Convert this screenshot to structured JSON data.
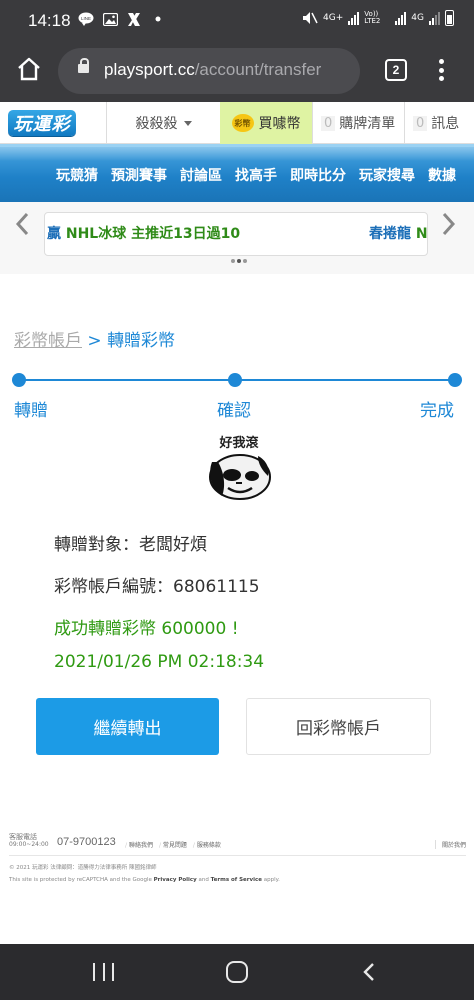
{
  "status_bar": {
    "time": "14:18",
    "network_label_1": "4G+",
    "network_label_2": "Vo)) LTE2",
    "network_label_3": "4G"
  },
  "browser": {
    "url_host": "playsport.cc",
    "url_path": "/account/transfer",
    "tab_count": "2"
  },
  "site_header": {
    "logo_text": "玩運彩",
    "user_name": "殺殺殺",
    "buy_coin_label": "買噱幣",
    "coin_badge": "彩幣",
    "card_list_count": "0",
    "card_list_label": "購牌清單",
    "message_count": "0",
    "message_label": "訊息"
  },
  "nav": {
    "items": [
      "玩競猜",
      "預測賽事",
      "討論區",
      "找高手",
      "即時比分",
      "玩家搜尋",
      "數據"
    ]
  },
  "ticker": {
    "item1_prefix": "贏",
    "item1_main": "NHL冰球 主推近13日過10",
    "item2_main": "春捲龍",
    "item2_suffix": "N"
  },
  "breadcrumb": {
    "parent": "彩幣帳戶",
    "separator": ">",
    "current": "轉贈彩幣"
  },
  "steps": {
    "labels": [
      "轉贈",
      "確認",
      "完成"
    ]
  },
  "sticker": {
    "text": "好我滾"
  },
  "result": {
    "target": "轉贈對象：老闆好煩",
    "account": "彩幣帳戶編號：68061115",
    "success": "成功轉贈彩幣 600000 !",
    "timestamp": "2021/01/26 PM 02:18:34"
  },
  "buttons": {
    "continue": "繼續轉出",
    "back": "回彩幣帳戶"
  },
  "footer": {
    "service_label": "客服電話",
    "service_hours": "09:00~24:00",
    "phone": "07-9700123",
    "links": [
      "聯絡我們",
      "常見問題",
      "服務條款"
    ],
    "right_link": "關於我們",
    "copyright": "© 2021 玩運彩 法律顧問：道勝得力法律事務所 陳國銘律師",
    "recaptcha_pre": "This site is protected by reCAPTCHA and the Google",
    "privacy": "Privacy Policy",
    "and": "and",
    "terms": "Terms of Service",
    "apply": "apply."
  },
  "colors": {
    "accent_blue": "#1e88d6",
    "success_green": "#2f9a12",
    "button_blue": "#1c9be6",
    "buy_coin_bg": "#dff3a3"
  }
}
